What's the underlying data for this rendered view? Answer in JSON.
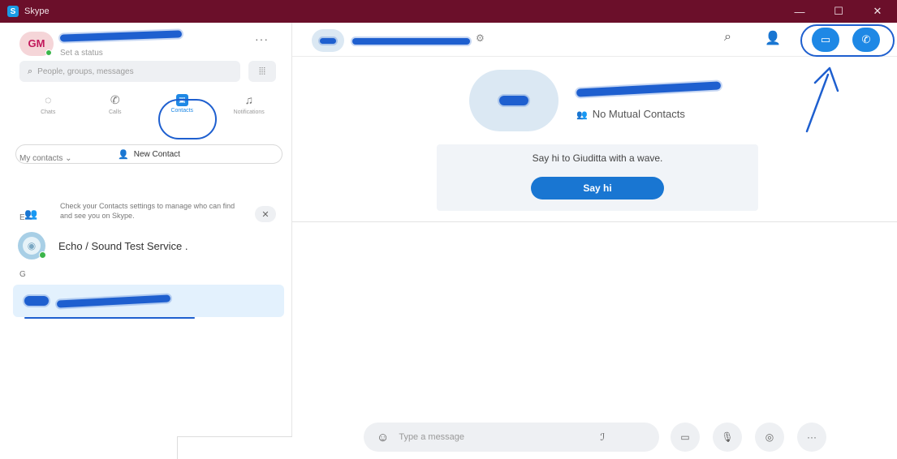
{
  "window": {
    "title": "Skype",
    "controls": {
      "minimize": "—",
      "maximize": "☐",
      "close": "✕"
    }
  },
  "profile": {
    "initials": "GM",
    "status": "Set a status",
    "more": "···"
  },
  "search": {
    "placeholder": "People, groups, messages",
    "dialpad": "⦙⦙⦙"
  },
  "nav": {
    "items": [
      {
        "label": "Chats",
        "icon": "chat-icon",
        "glyph": "◌"
      },
      {
        "label": "Calls",
        "icon": "phone-icon",
        "glyph": "✆"
      },
      {
        "label": "Contacts",
        "icon": "contacts-icon",
        "glyph": "▣",
        "active": true
      },
      {
        "label": "Notifications",
        "icon": "bell-icon",
        "glyph": "♫"
      }
    ]
  },
  "new_contact": {
    "label": "New Contact",
    "glyph": "👤"
  },
  "contacts": {
    "section_label": "My contacts ⌄",
    "tip": {
      "text": "Check your Contacts settings to manage who can find and see you on Skype.",
      "close": "✕"
    },
    "groups": [
      {
        "letter": "E",
        "name": "Echo / Sound Test Service ."
      },
      {
        "letter": "G",
        "name": ""
      }
    ]
  },
  "chat": {
    "mutual": "No Mutual Contacts",
    "wave_text": "Say hi to Giuditta with a wave.",
    "say_hi": "Say hi",
    "composer_placeholder": "Type a message"
  },
  "header_icons": {
    "search": "⌕",
    "add_people": "👤",
    "video": "▭",
    "call": "✆"
  },
  "composer_buttons": [
    {
      "name": "contact-card-button",
      "glyph": "▭"
    },
    {
      "name": "microphone-button",
      "glyph": "🎙"
    },
    {
      "name": "location-button",
      "glyph": "◎"
    },
    {
      "name": "more-options-button",
      "glyph": "···"
    }
  ],
  "colors": {
    "titlebar": "#6b0f2a",
    "accent": "#1e88e5",
    "selected_row": "#e3f1fd",
    "online": "#3bb54a",
    "annotation_marker": "#1e5fcf"
  }
}
